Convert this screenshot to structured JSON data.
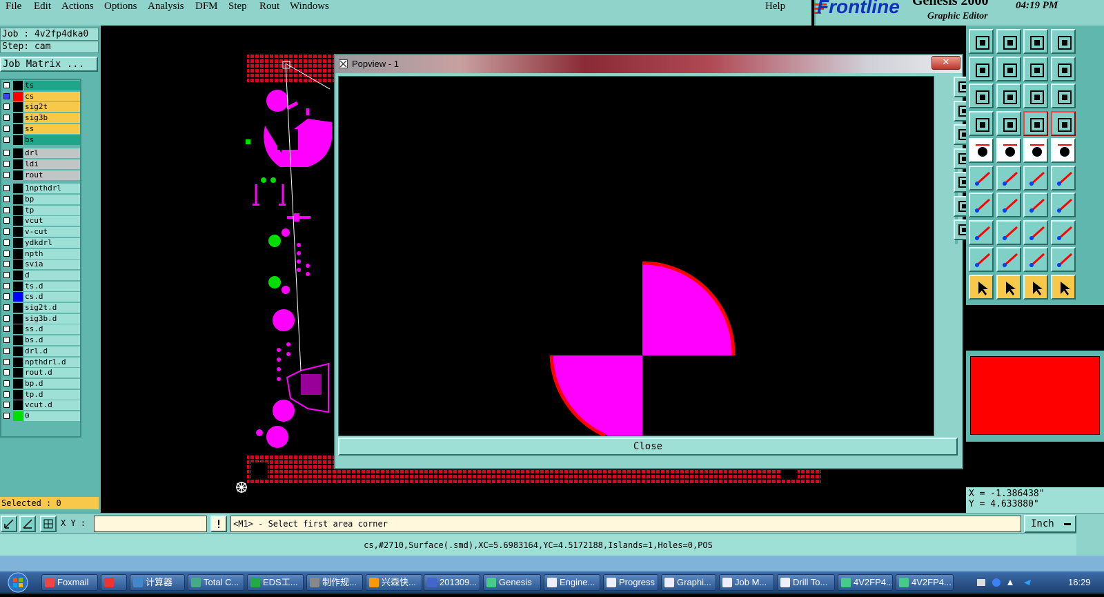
{
  "menu": {
    "items": [
      "File",
      "Edit",
      "Actions",
      "Options",
      "Analysis",
      "DFM",
      "Step",
      "Rout",
      "Windows"
    ],
    "help": "Help"
  },
  "brand": {
    "logo": "Frontline",
    "product": "Genesis 2000",
    "subtitle": "Graphic Editor",
    "time": "04:19 PM"
  },
  "job": {
    "job_line": "Job : 4v2fp4dka0",
    "step_line": "Step: cam",
    "matrix_button": "Job Matrix ..."
  },
  "layers": [
    {
      "name": "ts",
      "bg": "#1fa58a",
      "swatch": "#000000"
    },
    {
      "name": "cs",
      "bg": "#f7c84a",
      "swatch": "#ff0000",
      "active": true
    },
    {
      "name": "sig2t",
      "bg": "#f7c84a",
      "swatch": "#000000"
    },
    {
      "name": "sig3b",
      "bg": "#f7c84a",
      "swatch": "#000000"
    },
    {
      "name": "ss",
      "bg": "#f7c84a",
      "swatch": "#000000"
    },
    {
      "name": "bs",
      "bg": "#1fa58a",
      "swatch": "#000000"
    },
    {
      "name": "drl",
      "bg": "#bfc6c5",
      "swatch": "#000000"
    },
    {
      "name": "ldi",
      "bg": "#bfc6c5",
      "swatch": "#000000"
    },
    {
      "name": "rout",
      "bg": "#bfc6c5",
      "swatch": "#000000"
    },
    {
      "name": "1npthdrl",
      "bg": "#9fe0d6",
      "swatch": "#000000"
    },
    {
      "name": "bp",
      "bg": "#9fe0d6",
      "swatch": "#000000"
    },
    {
      "name": "tp",
      "bg": "#9fe0d6",
      "swatch": "#000000"
    },
    {
      "name": "vcut",
      "bg": "#9fe0d6",
      "swatch": "#000000"
    },
    {
      "name": "v-cut",
      "bg": "#9fe0d6",
      "swatch": "#000000"
    },
    {
      "name": "ydkdrl",
      "bg": "#9fe0d6",
      "swatch": "#000000"
    },
    {
      "name": "npth",
      "bg": "#9fe0d6",
      "swatch": "#000000"
    },
    {
      "name": "svia",
      "bg": "#9fe0d6",
      "swatch": "#000000"
    },
    {
      "name": "d",
      "bg": "#9fe0d6",
      "swatch": "#000000"
    },
    {
      "name": "ts.d",
      "bg": "#9fe0d6",
      "swatch": "#000000"
    },
    {
      "name": "cs.d",
      "bg": "#9fe0d6",
      "swatch": "#0000ff"
    },
    {
      "name": "sig2t.d",
      "bg": "#9fe0d6",
      "swatch": "#000000"
    },
    {
      "name": "sig3b.d",
      "bg": "#9fe0d6",
      "swatch": "#000000"
    },
    {
      "name": "ss.d",
      "bg": "#9fe0d6",
      "swatch": "#000000"
    },
    {
      "name": "bs.d",
      "bg": "#9fe0d6",
      "swatch": "#000000"
    },
    {
      "name": "drl.d",
      "bg": "#9fe0d6",
      "swatch": "#000000"
    },
    {
      "name": "npthdrl.d",
      "bg": "#9fe0d6",
      "swatch": "#000000"
    },
    {
      "name": "rout.d",
      "bg": "#9fe0d6",
      "swatch": "#000000"
    },
    {
      "name": "bp.d",
      "bg": "#9fe0d6",
      "swatch": "#000000"
    },
    {
      "name": "tp.d",
      "bg": "#9fe0d6",
      "swatch": "#000000"
    },
    {
      "name": "vcut.d",
      "bg": "#9fe0d6",
      "swatch": "#000000"
    },
    {
      "name": "0",
      "bg": "#9fe0d6",
      "swatch": "#00dd00"
    }
  ],
  "selected": "Selected : 0",
  "popview": {
    "title": "Popview - 1",
    "close_button": "Close",
    "close_glyph": "✕"
  },
  "coords": {
    "x": "X = -1.386438\"",
    "y": "Y =  4.633880\""
  },
  "command": {
    "xy_label": "X Y :",
    "xy_value": "",
    "prompt": "<M1> - Select first area corner",
    "unit": "Inch"
  },
  "status_line": "cs,#2710,Surface(.smd),XC=5.6983164,YC=4.5172188,Islands=1,Holes=0,POS",
  "colors": {
    "panel": "#8fd3cb",
    "highlight_red": "#ff0000",
    "magenta": "#ff00ff",
    "selected_bg": "#f7c84a"
  },
  "taskbar": {
    "items": [
      "Foxmail",
      "",
      "计算器",
      "Total C...",
      "EDS工...",
      "制作规...",
      "兴森快...",
      "201309...",
      "Genesis",
      "Engine...",
      "Progress",
      "Graphi...",
      "Job M...",
      "Drill To...",
      "4V2FP4...",
      "4V2FP4..."
    ],
    "clock": "16:29"
  }
}
